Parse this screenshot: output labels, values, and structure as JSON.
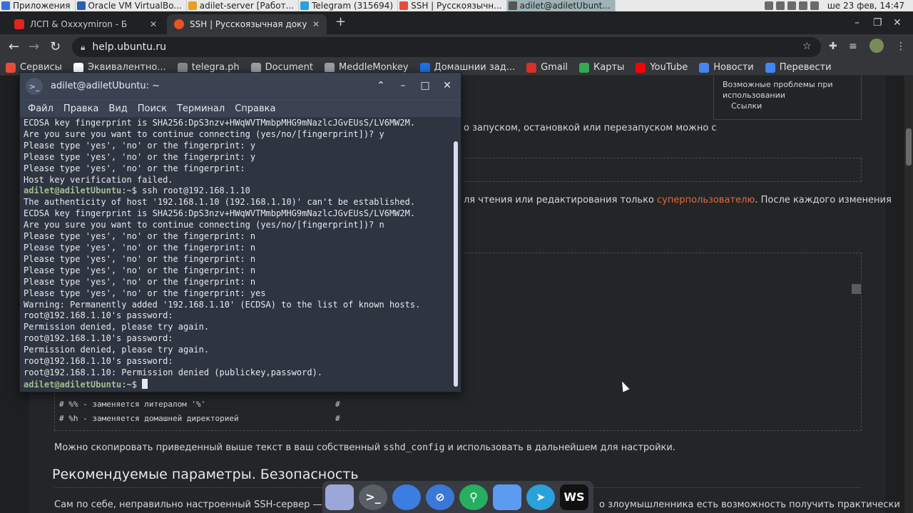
{
  "top_panel": {
    "items": [
      {
        "label": "Приложения",
        "color": "#3a6fd8"
      },
      {
        "label": "Oracle VM VirtualBo...",
        "color": "#2a5fb0"
      },
      {
        "label": "adilet-server [Работ...",
        "color": "#e8a020"
      },
      {
        "label": "Telegram (315694)",
        "color": "#2aa1da"
      },
      {
        "label": "SSH | Русскоязычн...",
        "color": "#e74c3c"
      },
      {
        "label": "adilet@adiletUbunt...",
        "color": "#555"
      }
    ],
    "clock": "ше 23 фев, 14:47"
  },
  "browser": {
    "tabs": [
      {
        "title": "ЛСП & Oxxxymiron - Б",
        "favicon_color": "#e0261b"
      },
      {
        "title": "SSH | Русскоязычная доку",
        "favicon_color": "#e95420"
      }
    ],
    "url": "help.ubuntu.ru",
    "bookmarks": [
      {
        "label": "Сервисы",
        "color": "#e74c3c"
      },
      {
        "label": "Эквивалентно...",
        "color": "#ffffff"
      },
      {
        "label": "telegra.ph",
        "color": "#888"
      },
      {
        "label": "Document",
        "color": "#9aa0a6"
      },
      {
        "label": "MeddleMonkey",
        "color": "#9aa0a6"
      },
      {
        "label": "Домашнии зад...",
        "color": "#1a73e8"
      },
      {
        "label": "Gmail",
        "color": "#d93025"
      },
      {
        "label": "Карты",
        "color": "#34a853"
      },
      {
        "label": "YouTube",
        "color": "#ff0000"
      },
      {
        "label": "Новости",
        "color": "#4285f4"
      },
      {
        "label": "Перевести",
        "color": "#4285f4"
      }
    ]
  },
  "page": {
    "toc": [
      "Возможные проблемы при",
      "использовании",
      "Ссылки"
    ],
    "line1": "о запуском, остановкой или перезапуском можно с",
    "line2_a": "ля чтения или редактирования только ",
    "line2_link": "суперпользователю",
    "line2_b": ". После каждого изменения",
    "code_lines": [
      {
        "text": "# %% - заменяется литералом '%'",
        "hash": "#"
      },
      {
        "text": "# %h - заменяется домашней директорией",
        "hash": "#"
      }
    ],
    "para_a": "Можно скопировать приведенный выше текст в ваш собственный ",
    "para_code": "sshd_config",
    "para_b": " и использовать в дальнейшем для настройки.",
    "heading": "Рекомендуемые параметры. Безопасность",
    "bottom_a": "Сам по себе, неправильно настроенный SSH-сервер — огро",
    "bottom_b": "о злоумышленника есть возможность получить практически"
  },
  "terminal": {
    "title": "adilet@adiletUbuntu: ~",
    "menu": [
      "Файл",
      "Правка",
      "Вид",
      "Поиск",
      "Терминал",
      "Справка"
    ],
    "prompt": "adilet@adiletUbuntu",
    "lines": [
      {
        "type": "out",
        "text": "ECDSA key fingerprint is SHA256:DpS3nzv+HWqWVTMmbpMHG9mNazlcJGvEUsS/LV6MW2M."
      },
      {
        "type": "out",
        "text": "Are you sure you want to continue connecting (yes/no/[fingerprint])? y"
      },
      {
        "type": "out",
        "text": "Please type 'yes', 'no' or the fingerprint: y"
      },
      {
        "type": "out",
        "text": "Please type 'yes', 'no' or the fingerprint: y"
      },
      {
        "type": "out",
        "text": "Please type 'yes', 'no' or the fingerprint:"
      },
      {
        "type": "out",
        "text": "Host key verification failed."
      },
      {
        "type": "cmd",
        "text": ":~$ ssh root@192.168.1.10"
      },
      {
        "type": "out",
        "text": "The authenticity of host '192.168.1.10 (192.168.1.10)' can't be established."
      },
      {
        "type": "out",
        "text": "ECDSA key fingerprint is SHA256:DpS3nzv+HWqWVTMmbpMHG9mNazlcJGvEUsS/LV6MW2M."
      },
      {
        "type": "out",
        "text": "Are you sure you want to continue connecting (yes/no/[fingerprint])? n"
      },
      {
        "type": "out",
        "text": "Please type 'yes', 'no' or the fingerprint: n"
      },
      {
        "type": "out",
        "text": "Please type 'yes', 'no' or the fingerprint: n"
      },
      {
        "type": "out",
        "text": "Please type 'yes', 'no' or the fingerprint: n"
      },
      {
        "type": "out",
        "text": "Please type 'yes', 'no' or the fingerprint: n"
      },
      {
        "type": "out",
        "text": "Please type 'yes', 'no' or the fingerprint: n"
      },
      {
        "type": "out",
        "text": "Please type 'yes', 'no' or the fingerprint: yes"
      },
      {
        "type": "out",
        "text": "Warning: Permanently added '192.168.1.10' (ECDSA) to the list of known hosts."
      },
      {
        "type": "out",
        "text": "root@192.168.1.10's password:"
      },
      {
        "type": "out",
        "text": "Permission denied, please try again."
      },
      {
        "type": "out",
        "text": "root@192.168.1.10's password:"
      },
      {
        "type": "out",
        "text": "Permission denied, please try again."
      },
      {
        "type": "out",
        "text": "root@192.168.1.10's password:"
      },
      {
        "type": "out",
        "text": "root@192.168.1.10: Permission denied (publickey,password)."
      },
      {
        "type": "cmd",
        "text": ":~$ "
      }
    ]
  },
  "dock": [
    {
      "name": "files-icon",
      "color": "#9aa7d8"
    },
    {
      "name": "terminal-icon",
      "color": "#5a5f66"
    },
    {
      "name": "browser-icon",
      "color": "#3b7de0"
    },
    {
      "name": "compass-icon",
      "color": "#3a78d8"
    },
    {
      "name": "search-icon",
      "color": "#27ae60"
    },
    {
      "name": "folder-icon",
      "color": "#5b9bf0"
    },
    {
      "name": "telegram-icon",
      "color": "#2aa1da"
    },
    {
      "name": "webstorm-icon",
      "color": "#111111"
    }
  ]
}
